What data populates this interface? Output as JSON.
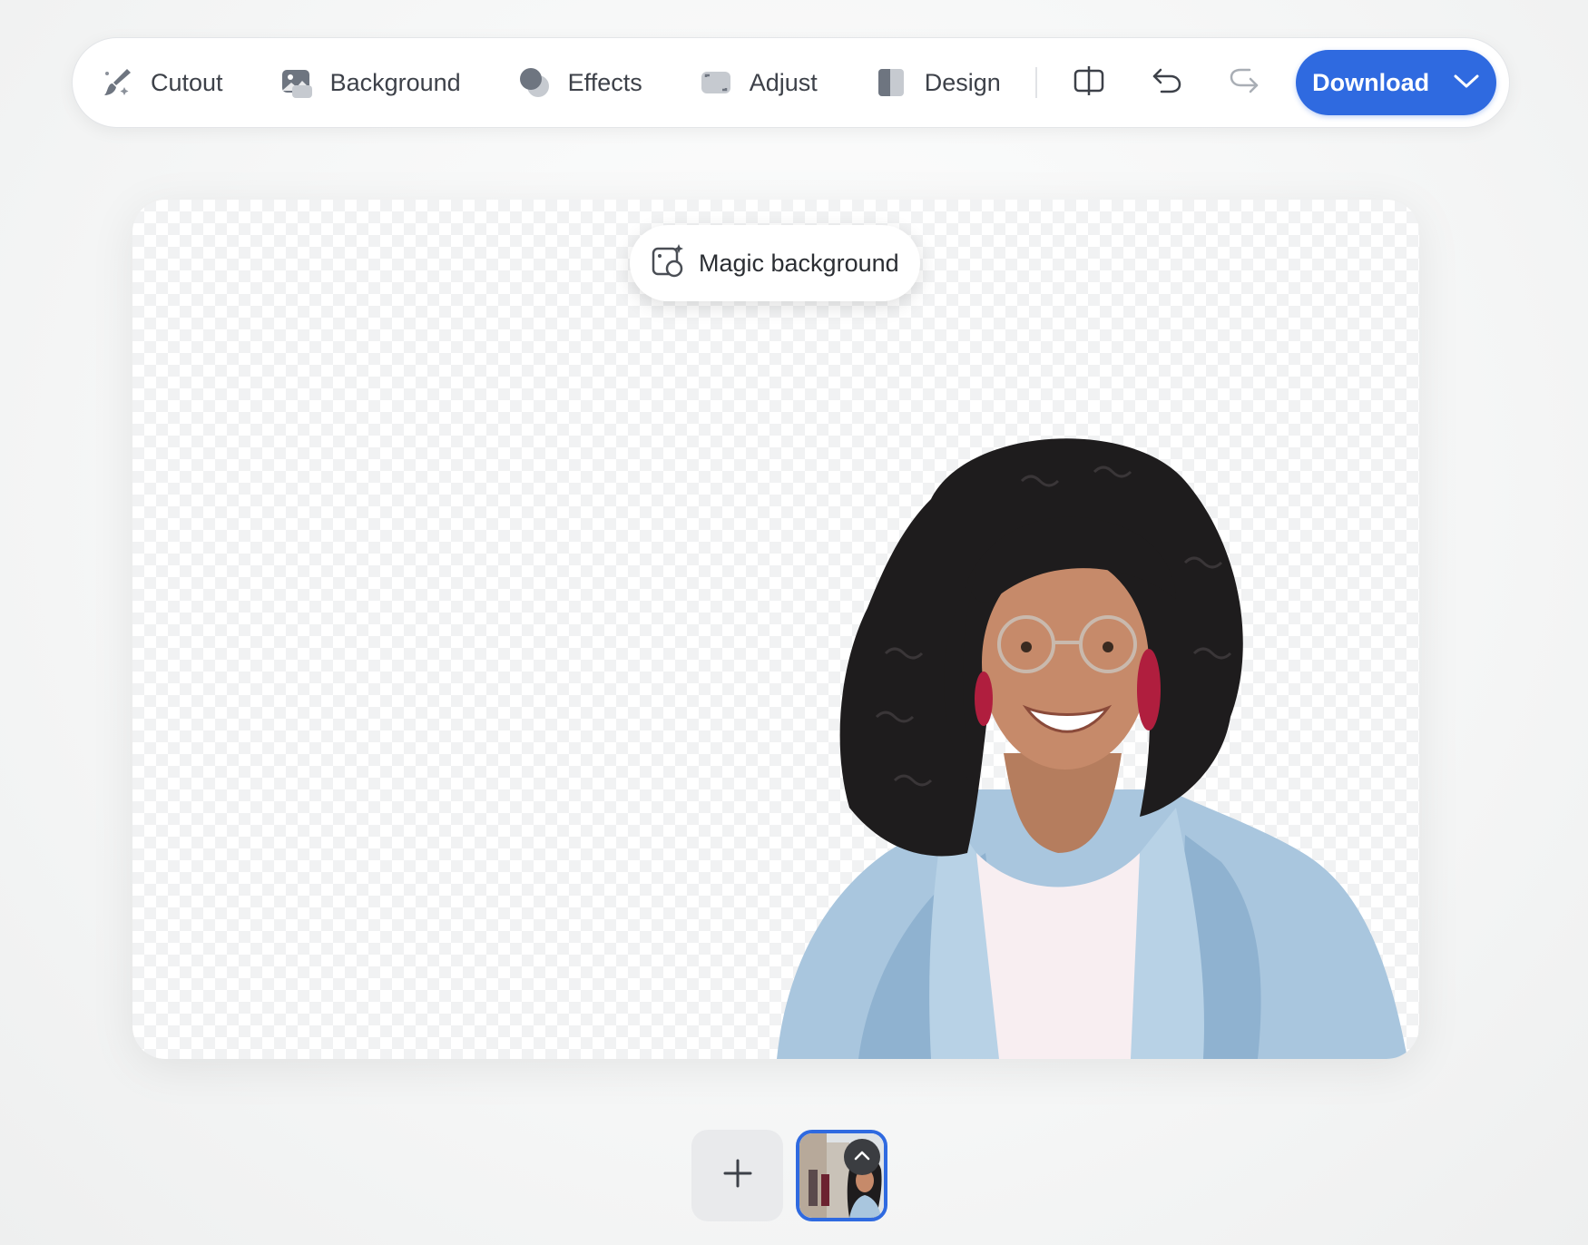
{
  "toolbar": {
    "tools": [
      {
        "label": "Cutout",
        "icon": "brush-icon"
      },
      {
        "label": "Background",
        "icon": "image-icon"
      },
      {
        "label": "Effects",
        "icon": "effects-circles-icon"
      },
      {
        "label": "Adjust",
        "icon": "adjust-icon"
      },
      {
        "label": "Design",
        "icon": "design-layout-icon"
      }
    ],
    "compare_icon": "compare-split-icon",
    "undo_icon": "undo-icon",
    "redo_icon": "redo-icon",
    "download_label": "Download",
    "download_icon": "chevron-down-icon",
    "accent_color": "#2f6ae0"
  },
  "canvas": {
    "magic_background_label": "Magic background",
    "magic_background_icon": "magic-background-icon",
    "transparent_background": true
  },
  "pages": {
    "add_icon": "plus-icon",
    "thumbnail_collapse_icon": "chevron-up-icon",
    "selected_page": 1
  }
}
